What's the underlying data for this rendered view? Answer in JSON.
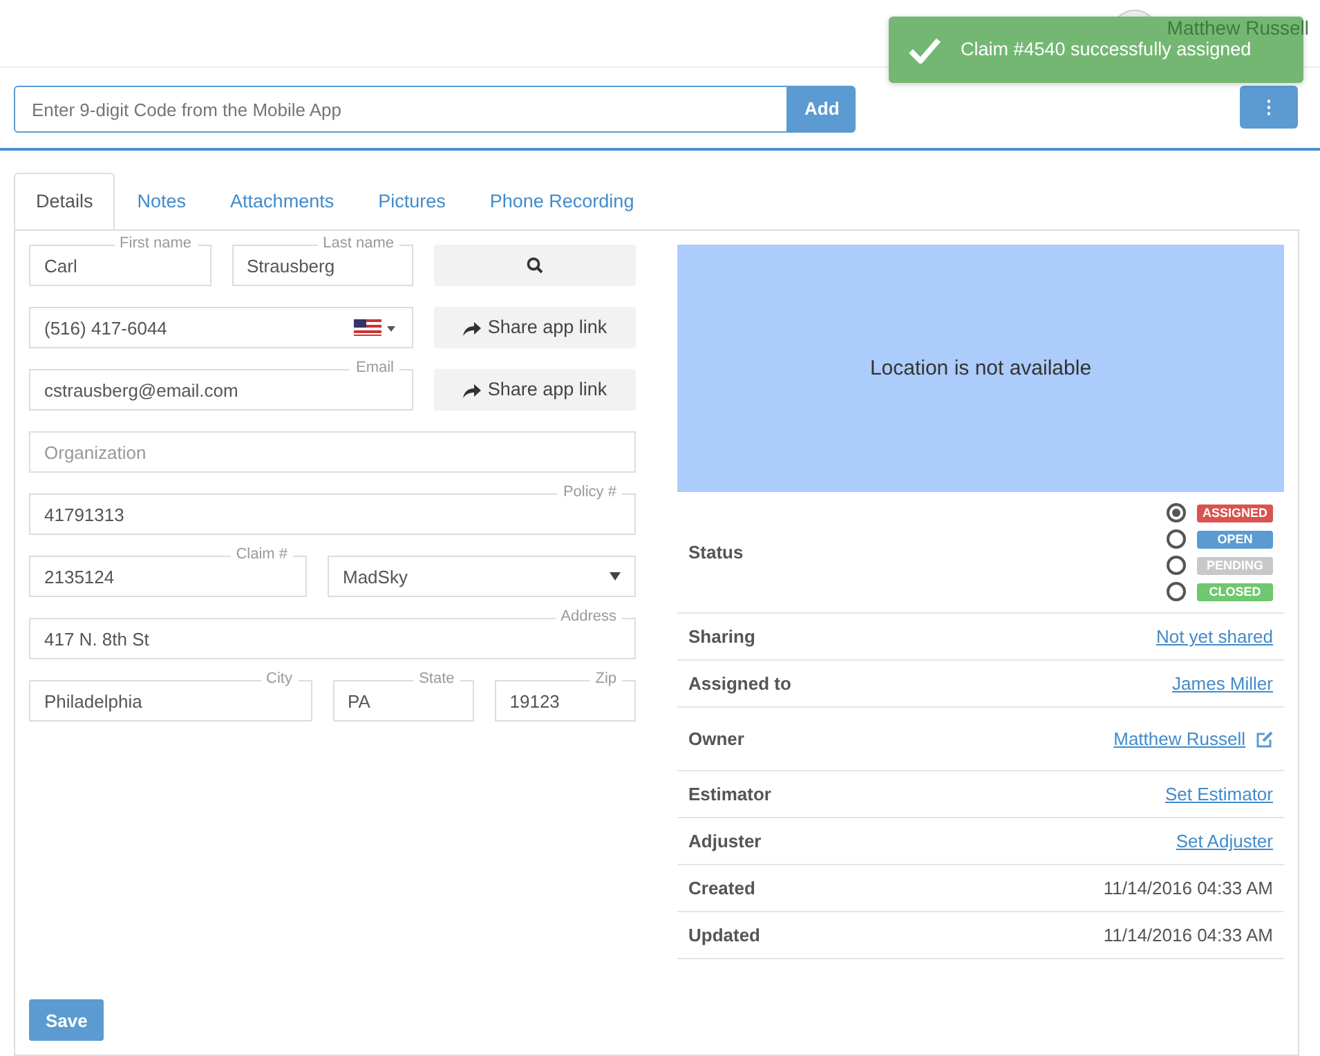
{
  "header": {
    "user": "Matthew Russell"
  },
  "toast": {
    "message": "Claim #4540 successfully assigned"
  },
  "code_bar": {
    "placeholder": "Enter 9-digit Code from the Mobile App",
    "add_label": "Add",
    "more_label": "⋮"
  },
  "tabs": [
    {
      "label": "Details",
      "selected": true
    },
    {
      "label": "Notes",
      "selected": false
    },
    {
      "label": "Attachments",
      "selected": false
    },
    {
      "label": "Pictures",
      "selected": false
    },
    {
      "label": "Phone Recording",
      "selected": false
    }
  ],
  "form_rows": [
    [
      {
        "kind": "field",
        "label": "First name",
        "value": "Carl"
      },
      {
        "kind": "field",
        "label": "Last name",
        "value": "Strausberg"
      },
      {
        "kind": "search"
      }
    ],
    [
      {
        "kind": "phone",
        "value": "(516) 417-6044"
      },
      {
        "kind": "share",
        "label": "Share app link"
      }
    ],
    [
      {
        "kind": "field",
        "label": "Email",
        "value": "cstrausberg@email.com"
      },
      {
        "kind": "share",
        "label": "Share app link"
      }
    ],
    [
      {
        "kind": "field",
        "placeholder": "Organization"
      }
    ],
    [
      {
        "kind": "field",
        "label": "Policy #",
        "value": "41791313"
      }
    ],
    [
      {
        "kind": "field",
        "label": "Claim #",
        "value": "2135124"
      },
      {
        "kind": "select",
        "value": "MadSky"
      }
    ],
    [
      {
        "kind": "field",
        "label": "Address",
        "value": "417 N. 8th St"
      }
    ],
    [
      {
        "kind": "field",
        "label": "City",
        "value": "Philadelphia"
      },
      {
        "kind": "field",
        "label": "State",
        "value": "PA"
      },
      {
        "kind": "field",
        "label": "Zip",
        "value": "19123"
      }
    ]
  ],
  "save_label": "Save",
  "map": {
    "message": "Location is not available"
  },
  "info_rows": [
    {
      "label": "Status",
      "kind": "status",
      "statuses": [
        {
          "label": "ASSIGNED",
          "color": "#d9534f",
          "selected": true
        },
        {
          "label": "OPEN",
          "color": "#5b9bd1",
          "selected": false
        },
        {
          "label": "PENDING",
          "color": "#c8c8c8",
          "selected": false
        },
        {
          "label": "CLOSED",
          "color": "#6fc76f",
          "selected": false
        }
      ]
    },
    {
      "label": "Sharing",
      "kind": "link",
      "value": "Not yet shared"
    },
    {
      "label": "Assigned to",
      "kind": "link",
      "value": "James Miller"
    },
    {
      "label": "Owner",
      "kind": "link",
      "value": "Matthew Russell",
      "editable": true
    },
    {
      "label": "Estimator",
      "kind": "link",
      "value": "Set Estimator"
    },
    {
      "label": "Adjuster",
      "kind": "link",
      "value": "Set Adjuster"
    },
    {
      "label": "Created",
      "kind": "text",
      "value": "11/14/2016 04:33 AM"
    },
    {
      "label": "Updated",
      "kind": "text",
      "value": "11/14/2016 04:33 AM"
    }
  ]
}
